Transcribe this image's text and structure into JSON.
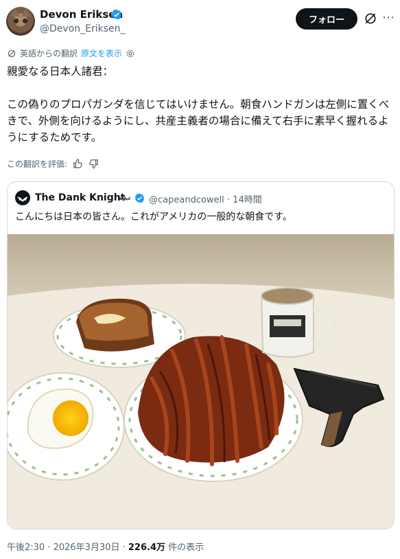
{
  "author": {
    "name": "Devon Eriksen",
    "handle": "@Devon_Eriksen_"
  },
  "follow_label": "フォロー",
  "translation": {
    "note": "英語からの翻訳",
    "show_original": "原文を表示"
  },
  "tweet_text": "親愛なる日本人諸君：\n\nこの偽りのプロパガンダを信じてはいけません。朝食ハンドガンは左側に置くべきで、外側を向けるようにし、共産主義者の場合に備えて右手に素早く握れるようにするためです。",
  "rate_label": "この翻訳を評価:",
  "quoted": {
    "name": "The Dank Knight",
    "handle": "@capeandcowell",
    "time": "· 14時間",
    "text": "こんにちは日本の皆さん。これがアメリカの一般的な朝食です。"
  },
  "footer": {
    "time": "午後2:30 · 2026年3月30日 · ",
    "views": "226.4万",
    "views_suffix": " 件の表示"
  },
  "colors": {
    "accent": "#1d9bf0",
    "text": "#0f1419",
    "muted": "#536471",
    "border": "#cfd9de"
  },
  "icons": [
    "verified-badge-icon",
    "grok-icon",
    "more-icon",
    "translate-icon",
    "settings-gear-icon",
    "thumbs-up-icon",
    "thumbs-down-icon",
    "bat-icon"
  ]
}
